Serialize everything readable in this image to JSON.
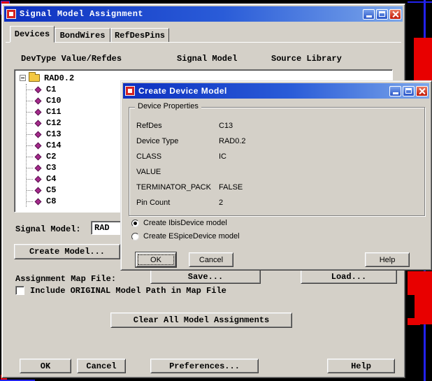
{
  "main": {
    "title": "Signal Model Assignment",
    "tabs": [
      {
        "label": "Devices"
      },
      {
        "label": "BondWires"
      },
      {
        "label": "RefDesPins"
      }
    ],
    "columns": [
      "DevType Value/Refdes",
      "Signal Model",
      "Source Library"
    ],
    "tree": {
      "root": "RAD0.2",
      "items": [
        "C1",
        "C10",
        "C11",
        "C12",
        "C13",
        "C14",
        "C2",
        "C3",
        "C4",
        "C5",
        "C8"
      ]
    },
    "signal_model": {
      "label": "Signal Model:",
      "value": "RAD"
    },
    "map": {
      "label": "Assignment Map File:",
      "save": "Save...",
      "load": "Load...",
      "include": "Include ORIGINAL Model Path in Map File"
    },
    "buttons": {
      "create_model": "Create Model...",
      "clear": "Clear All Model Assignments",
      "ok": "OK",
      "cancel": "Cancel",
      "preferences": "Preferences...",
      "help": "Help"
    }
  },
  "dialog": {
    "title": "Create Device Model",
    "group": "Device Properties",
    "props": [
      {
        "label": "RefDes",
        "value": "C13"
      },
      {
        "label": "Device Type",
        "value": "RAD0.2"
      },
      {
        "label": "CLASS",
        "value": "IC"
      },
      {
        "label": "VALUE",
        "value": ""
      },
      {
        "label": "TERMINATOR_PACK",
        "value": "FALSE"
      },
      {
        "label": "Pin Count",
        "value": "2"
      }
    ],
    "radios": [
      {
        "label": "Create IbisDevice model",
        "selected": true
      },
      {
        "label": "Create ESpiceDevice model",
        "selected": false
      }
    ],
    "buttons": {
      "ok": "OK",
      "cancel": "Cancel",
      "help": "Help"
    }
  },
  "colors": {
    "titlebar_start": "#0d30c0",
    "titlebar_end": "#7ba6ea",
    "dialog_bg": "#d4d0c8",
    "pcb_red": "#e80000",
    "pcb_blue": "#2222ee",
    "tree_diamond": "#a62a8c"
  }
}
